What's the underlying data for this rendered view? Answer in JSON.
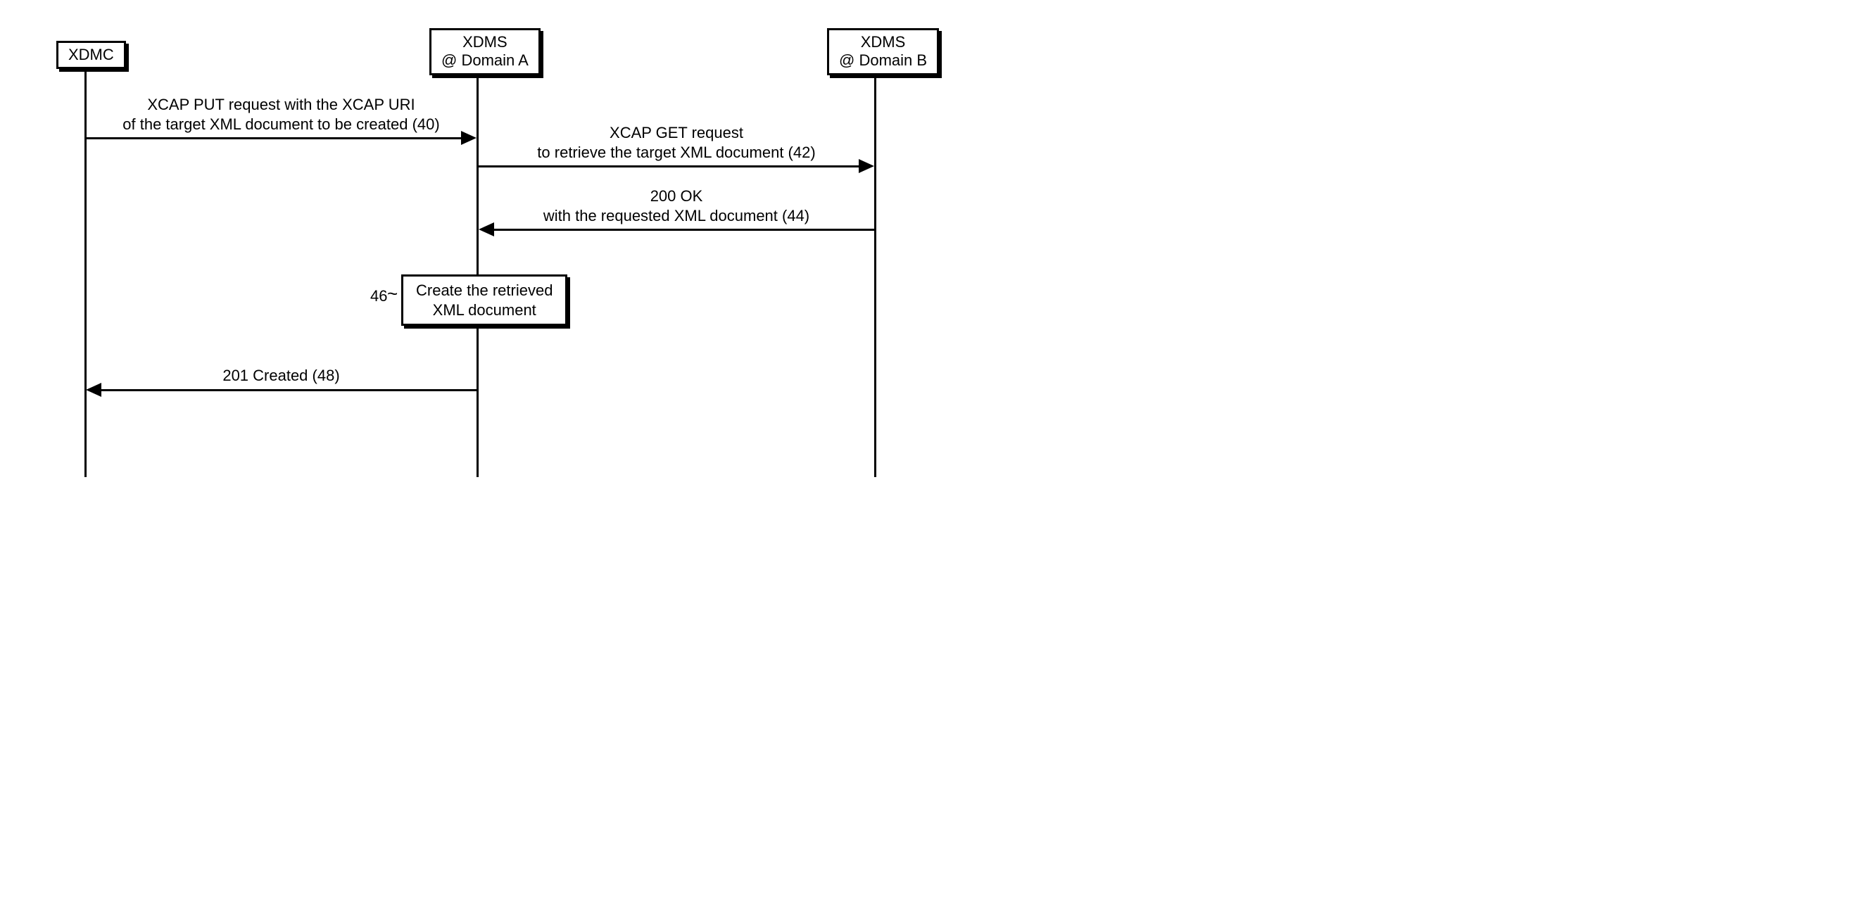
{
  "actors": {
    "xdmc": "XDMC",
    "xdmsA_line1": "XDMS",
    "xdmsA_line2": "@ Domain A",
    "xdmsB_line1": "XDMS",
    "xdmsB_line2": "@ Domain B"
  },
  "messages": {
    "m40_line1": "XCAP PUT request with the XCAP URI",
    "m40_line2": "of the target XML document to be created (40)",
    "m42_line1": "XCAP GET request",
    "m42_line2": "to retrieve the target XML document (42)",
    "m44_line1": "200 OK",
    "m44_line2": "with the requested XML document (44)",
    "m48": "201 Created (48)"
  },
  "activity": {
    "a46_line1": "Create the retrieved",
    "a46_line2": "XML document",
    "a46_ref": "46"
  }
}
